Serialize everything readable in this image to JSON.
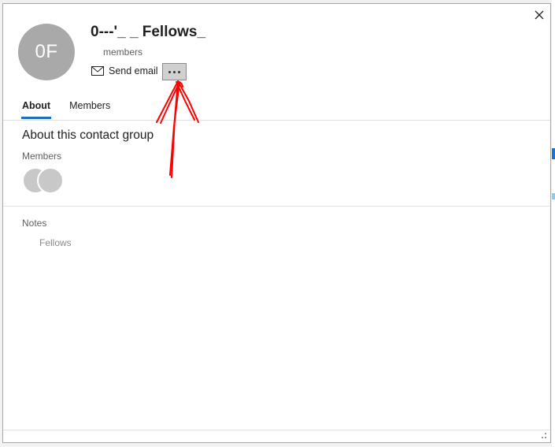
{
  "dialog": {
    "close_icon": "close-icon",
    "avatar_initials": "0F",
    "group_name": "0---'_ _ Fellows_",
    "member_count_label": "members",
    "actions": {
      "send_email_label": "Send email",
      "send_email_icon": "mail-icon",
      "more_icon": "more-options-icon"
    },
    "tabs": [
      {
        "label": "About",
        "active": true
      },
      {
        "label": "Members",
        "active": false
      }
    ],
    "about": {
      "section_title": "About this contact group",
      "members_label": "Members",
      "notes_label": "Notes",
      "notes_value": "Fellows"
    }
  },
  "annotation": {
    "type": "hand-drawn-arrow",
    "color": "#ff0000",
    "points_to": "more-options-button"
  }
}
